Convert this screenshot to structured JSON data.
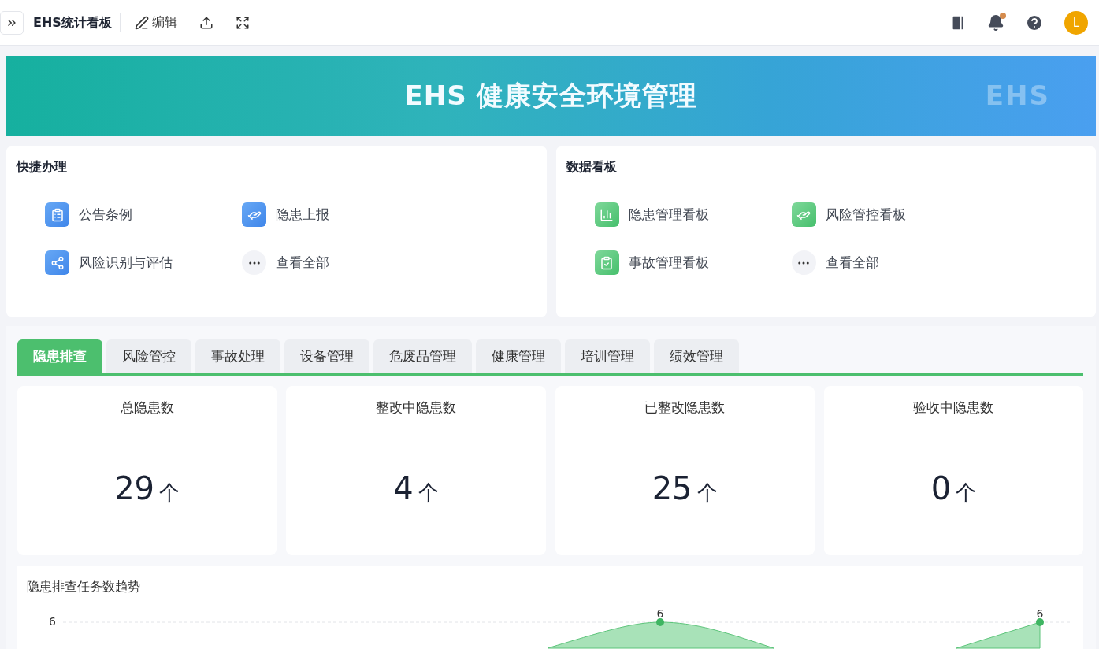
{
  "topbar": {
    "title": "EHS统计看板",
    "edit_label": "编辑",
    "avatar_letter": "L",
    "notification_dot": true
  },
  "banner": {
    "title": "EHS 健康安全环境管理",
    "watermark": "EHS"
  },
  "panels": [
    {
      "title": "快捷办理",
      "kind": "quick",
      "items": [
        {
          "label": "公告条例",
          "kind": "link"
        },
        {
          "label": "隐患上报",
          "kind": "link"
        },
        {
          "label": "风险识别与评估",
          "kind": "link"
        },
        {
          "label": "查看全部",
          "kind": "more"
        }
      ]
    },
    {
      "title": "数据看板",
      "kind": "board",
      "items": [
        {
          "label": "隐患管理看板",
          "kind": "link"
        },
        {
          "label": "风险管控看板",
          "kind": "link"
        },
        {
          "label": "事故管理看板",
          "kind": "link"
        },
        {
          "label": "查看全部",
          "kind": "more"
        }
      ]
    }
  ],
  "tabs": [
    {
      "label": "隐患排查",
      "selected": true
    },
    {
      "label": "风险管控",
      "selected": false
    },
    {
      "label": "事故处理",
      "selected": false
    },
    {
      "label": "设备管理",
      "selected": false
    },
    {
      "label": "危废品管理",
      "selected": false
    },
    {
      "label": "健康管理",
      "selected": false
    },
    {
      "label": "培训管理",
      "selected": false
    },
    {
      "label": "绩效管理",
      "selected": false
    }
  ],
  "stats": [
    {
      "label": "总隐患数",
      "value": "29",
      "unit": "个"
    },
    {
      "label": "整改中隐患数",
      "value": "4",
      "unit": "个"
    },
    {
      "label": "已整改隐患数",
      "value": "25",
      "unit": "个"
    },
    {
      "label": "验收中隐患数",
      "value": "0",
      "unit": "个"
    }
  ],
  "trend": {
    "title": "隐患排查任务数趋势",
    "y_tick_label": "6",
    "point_labels": [
      "6",
      "6"
    ]
  }
}
